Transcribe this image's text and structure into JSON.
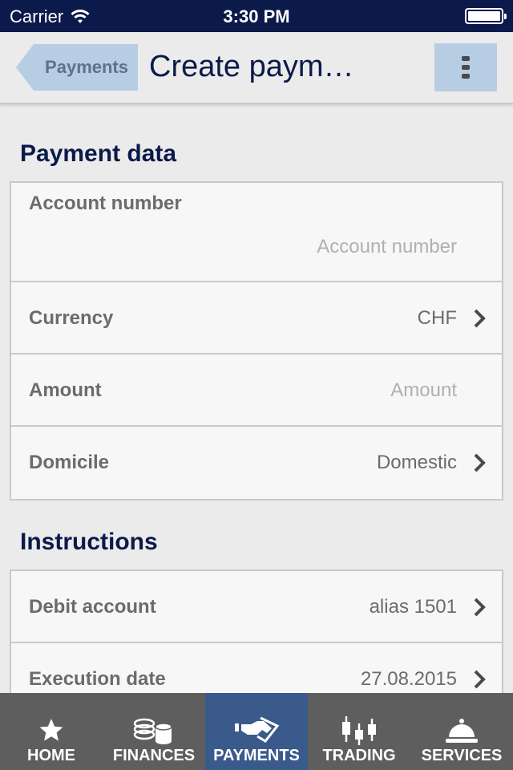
{
  "status_bar": {
    "carrier": "Carrier",
    "time": "3:30 PM",
    "battery_icon": "battery-full-icon",
    "wifi_icon": "wifi-icon"
  },
  "nav": {
    "back_label": "Payments",
    "title": "Create paym…",
    "menu_icon": "more-vertical-icon"
  },
  "payment_data": {
    "header": "Payment data",
    "account_number": {
      "label": "Account number",
      "placeholder": "Account number"
    },
    "currency": {
      "label": "Currency",
      "value": "CHF"
    },
    "amount": {
      "label": "Amount",
      "placeholder": "Amount"
    },
    "domicile": {
      "label": "Domicile",
      "value": "Domestic"
    }
  },
  "instructions": {
    "header": "Instructions",
    "debit_account": {
      "label": "Debit account",
      "value": "alias 1501"
    },
    "execution_date": {
      "label": "Execution date",
      "value": "27.08.2015"
    }
  },
  "tabs": [
    {
      "label": "HOME",
      "icon": "star-icon",
      "active": false
    },
    {
      "label": "FINANCES",
      "icon": "coins-icon",
      "active": false
    },
    {
      "label": "PAYMENTS",
      "icon": "handshake-icon",
      "active": true
    },
    {
      "label": "TRADING",
      "icon": "candlestick-chart-icon",
      "active": false
    },
    {
      "label": "SERVICES",
      "icon": "service-bell-icon",
      "active": false
    }
  ],
  "colors": {
    "navy": "#0b1a4a",
    "accent_light_blue": "#b7cde3",
    "active_tab": "#3b5a8c",
    "tab_bar": "#5e5e5e",
    "background": "#ebebeb"
  }
}
